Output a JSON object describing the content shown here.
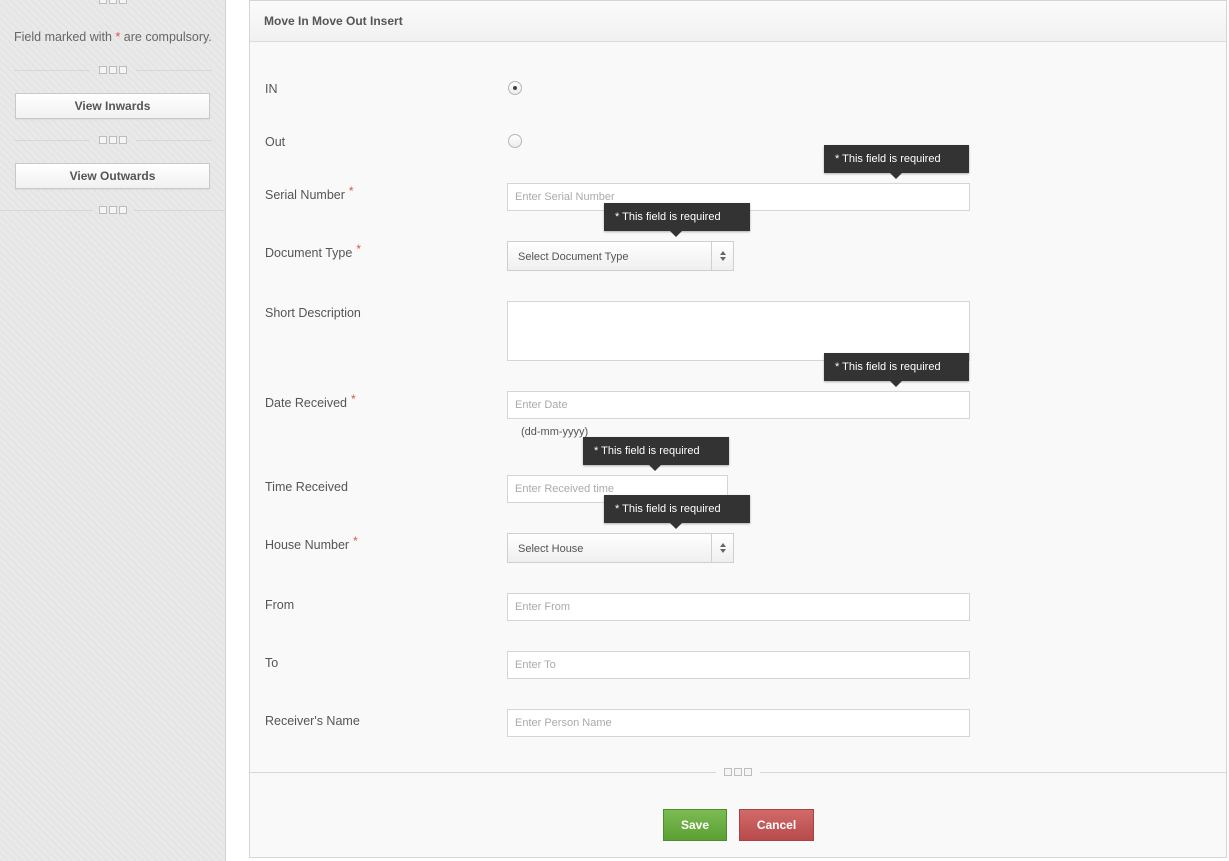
{
  "sidebar": {
    "compulsory_text_before": "Field marked with ",
    "compulsory_star": "*",
    "compulsory_text_after": " are compulsory.",
    "view_inwards": "View Inwards",
    "view_outwards": "View Outwards"
  },
  "form": {
    "title": "Move In Move Out Insert",
    "required_star": "*",
    "fields": {
      "in": {
        "label": "IN",
        "checked": true
      },
      "out": {
        "label": "Out",
        "checked": false
      },
      "serial_number": {
        "label": "Serial Number",
        "placeholder": "Enter Serial Number",
        "required": true
      },
      "document_type": {
        "label": "Document Type",
        "value": "Select Document Type",
        "required": true
      },
      "short_description": {
        "label": "Short Description",
        "placeholder": ""
      },
      "date_received": {
        "label": "Date Received",
        "placeholder": "Enter Date",
        "hint": "(dd-mm-yyyy)",
        "required": true
      },
      "time_received": {
        "label": "Time Received",
        "placeholder": "Enter Received time"
      },
      "house_number": {
        "label": "House Number",
        "value": "Select House",
        "required": true
      },
      "from": {
        "label": "From",
        "placeholder": "Enter From"
      },
      "to": {
        "label": "To",
        "placeholder": "Enter To"
      },
      "receivers_name": {
        "label": "Receiver's Name",
        "placeholder": "Enter Person Name"
      }
    },
    "tooltip_text": "* This field is required",
    "save_label": "Save",
    "cancel_label": "Cancel"
  },
  "colors": {
    "required_star": "#d9534f",
    "tooltip_bg": "#333333",
    "save_bg": "#6aae43",
    "cancel_bg": "#c45757"
  }
}
